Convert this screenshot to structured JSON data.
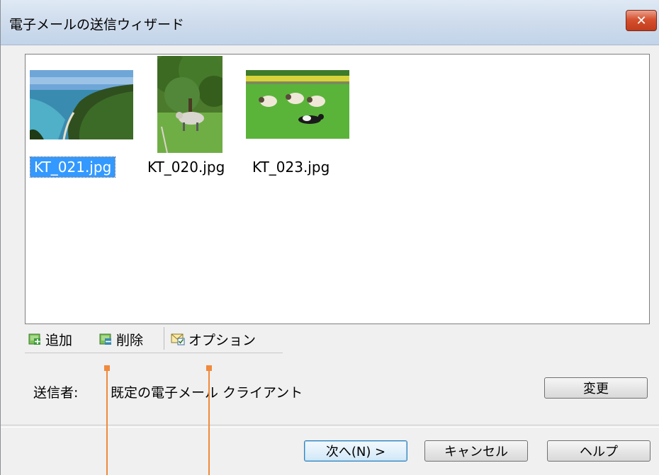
{
  "window": {
    "title": "電子メールの送信ウィザード",
    "close_glyph": "✕"
  },
  "files": [
    {
      "name": "KT_021.jpg",
      "selected": true,
      "thumbnail": "coastline-photo"
    },
    {
      "name": "KT_020.jpg",
      "selected": false,
      "thumbnail": "sheep-under-tree-photo"
    },
    {
      "name": "KT_023.jpg",
      "selected": false,
      "thumbnail": "sheep-and-dog-photo"
    }
  ],
  "toolbar": {
    "add_label": "追加",
    "remove_label": "削除",
    "options_label": "オプション"
  },
  "sender": {
    "label": "送信者:",
    "value": "既定の電子メール クライアント",
    "change_label": "変更"
  },
  "buttons": {
    "next_label": "次へ(N) >",
    "cancel_label": "キャンセル",
    "help_label": "ヘルプ"
  },
  "colors": {
    "selection": "#3399ff",
    "annotation": "#f08a3c"
  }
}
